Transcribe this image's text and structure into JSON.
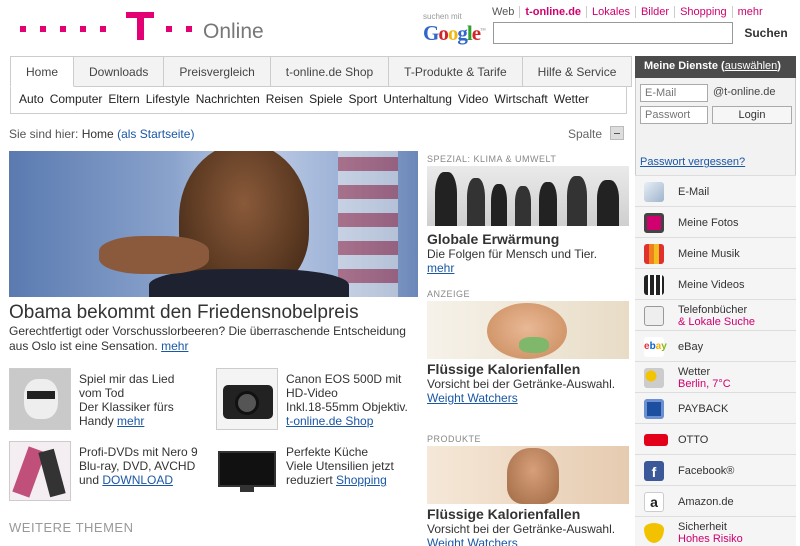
{
  "brand": {
    "online": "Online",
    "color": "#e20074"
  },
  "google": {
    "small": "suchen mit",
    "logo_letters": [
      "G",
      "o",
      "o",
      "g",
      "l",
      "e"
    ],
    "logo_colors": [
      "#3366cc",
      "#d2232a",
      "#f1b810",
      "#3366cc",
      "#2c9f2c",
      "#d2232a"
    ],
    "tm": "™"
  },
  "toplinks": [
    "Web",
    "t-online.de",
    "Lokales",
    "Bilder",
    "Shopping",
    "mehr"
  ],
  "search": {
    "value": "",
    "button": "Suchen"
  },
  "tabs": [
    "Home",
    "Downloads",
    "Preisvergleich",
    "t-online.de Shop",
    "T-Produkte & Tarife",
    "Hilfe & Service"
  ],
  "subnav": [
    "Auto",
    "Computer",
    "Eltern",
    "Lifestyle",
    "Nachrichten",
    "Reisen",
    "Spiele",
    "Sport",
    "Unterhaltung",
    "Video",
    "Wirtschaft",
    "Wetter"
  ],
  "breadcrumb": {
    "prefix": "Sie sind hier:",
    "home": "Home",
    "start": "(als Startseite)"
  },
  "spalte": "Spalte",
  "hero": {
    "title": "Obama bekommt den Friedensnobelpreis",
    "text": "Gerechtfertigt oder Vorschusslorbeeren? Die überraschende Entscheidung aus Oslo ist eine Sensation.",
    "more": "mehr"
  },
  "teasers": [
    {
      "title": "Spiel mir das Lied vom Tod",
      "text": "Der Klassiker fürs Handy",
      "link": "mehr"
    },
    {
      "title": "Canon EOS 500D mit HD-Video",
      "text": "Inkl.18-55mm Objektiv.",
      "link": "t-online.de Shop"
    },
    {
      "title": "Profi-DVDs mit Nero 9",
      "text": "Blu-ray, DVD, AVCHD und",
      "link": "DOWNLOAD"
    },
    {
      "title": "Perfekte Küche",
      "text": "Viele Utensilien jetzt reduziert",
      "link": "Shopping"
    }
  ],
  "weitere": "WEITERE THEMEN",
  "middle": [
    {
      "label": "SPEZIAL: KLIMA & UMWELT",
      "title": "Globale Erwärmung",
      "text": "Die Folgen für Mensch und Tier.",
      "link": "mehr"
    },
    {
      "label": "ANZEIGE",
      "title": "Flüssige Kalorienfallen",
      "text": "Vorsicht bei der Getränke-Auswahl.",
      "link": "Weight Watchers"
    },
    {
      "label": "PRODUKTE",
      "title": "Flüssige Kalorienfallen",
      "text": "Vorsicht bei der Getränke-Auswahl.",
      "link": "Weight Watchers"
    }
  ],
  "sidebar": {
    "head": "Meine Dienste",
    "auswaehlen": "auswählen",
    "email_placeholder": "E-Mail",
    "domain": "@t-online.de",
    "password_placeholder": "Passwort",
    "login": "Login",
    "forgot": "Passwort vergessen?",
    "items": [
      {
        "label": "E-Mail",
        "icon": "email-icon"
      },
      {
        "label": "Meine Fotos",
        "icon": "photos-icon"
      },
      {
        "label": "Meine Musik",
        "icon": "music-icon"
      },
      {
        "label": "Meine Videos",
        "icon": "video-icon"
      },
      {
        "label": "Telefonbücher",
        "sub": "& Lokale Suche",
        "icon": "phonebook-icon"
      },
      {
        "label": "eBay",
        "icon": "ebay-icon"
      },
      {
        "label": "Wetter",
        "sub": "Berlin, 7°C",
        "icon": "weather-icon"
      },
      {
        "label": "PAYBACK",
        "icon": "payback-icon"
      },
      {
        "label": "OTTO",
        "icon": "otto-icon"
      },
      {
        "label": "Facebook®",
        "icon": "facebook-icon"
      },
      {
        "label": "Amazon.de",
        "icon": "amazon-icon"
      },
      {
        "label": "Sicherheit",
        "sub": "Hohes Risiko",
        "icon": "security-icon"
      }
    ]
  }
}
